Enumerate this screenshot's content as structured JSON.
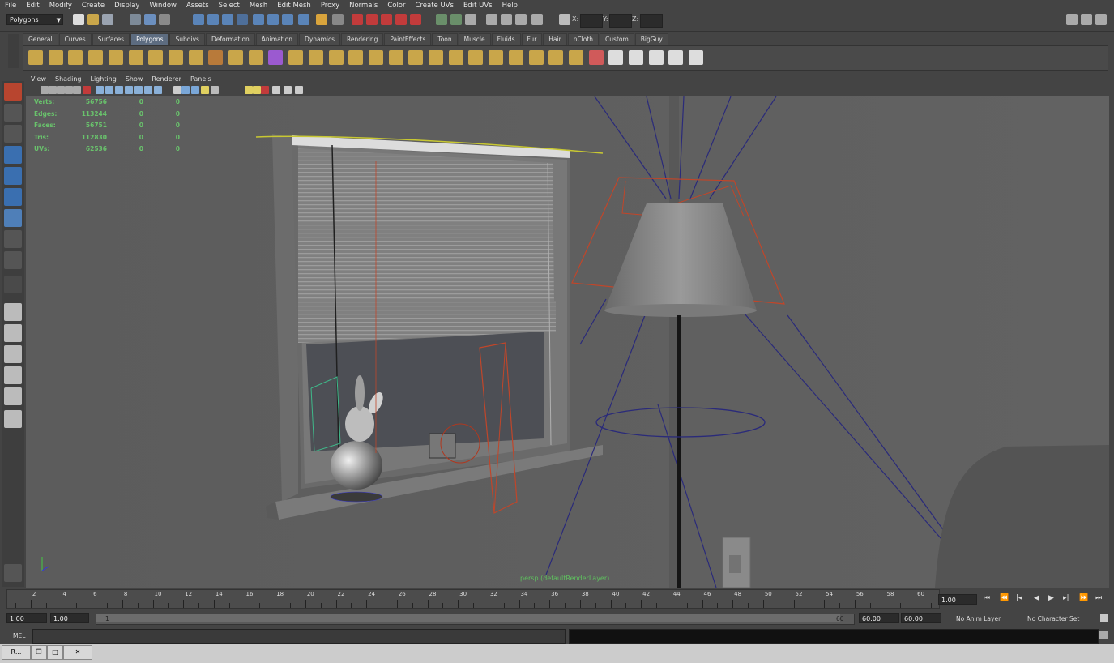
{
  "menubar": {
    "items": [
      "File",
      "Edit",
      "Modify",
      "Create",
      "Display",
      "Window",
      "Assets",
      "Select",
      "Mesh",
      "Edit Mesh",
      "Proxy",
      "Normals",
      "Color",
      "Create UVs",
      "Edit UVs",
      "Help"
    ]
  },
  "statusline": {
    "mode": "Polygons",
    "x_label": "X:",
    "y_label": "Y:",
    "z_label": "Z:"
  },
  "shelf": {
    "tabs": [
      "General",
      "Curves",
      "Surfaces",
      "Polygons",
      "Subdivs",
      "Deformation",
      "Animation",
      "Dynamics",
      "Rendering",
      "PaintEffects",
      "Toon",
      "Muscle",
      "Fluids",
      "Fur",
      "Hair",
      "nCloth",
      "Custom",
      "BigGuy"
    ],
    "active_tab": "Polygons"
  },
  "panel": {
    "menus": [
      "View",
      "Shading",
      "Lighting",
      "Show",
      "Renderer",
      "Panels"
    ],
    "camera_label": "persp (defaultRenderLayer)"
  },
  "hud": {
    "rows": [
      {
        "label": "Verts:",
        "value": "56756",
        "a": "0",
        "b": "0"
      },
      {
        "label": "Edges:",
        "value": "113244",
        "a": "0",
        "b": "0"
      },
      {
        "label": "Faces:",
        "value": "56751",
        "a": "0",
        "b": "0"
      },
      {
        "label": "Tris:",
        "value": "112830",
        "a": "0",
        "b": "0"
      },
      {
        "label": "UVs:",
        "value": "62536",
        "a": "0",
        "b": "0"
      }
    ]
  },
  "timeslider": {
    "ticks": [
      "2",
      "4",
      "6",
      "8",
      "10",
      "12",
      "14",
      "16",
      "18",
      "20",
      "22",
      "24",
      "26",
      "28",
      "30",
      "32",
      "34",
      "36",
      "38",
      "40",
      "42",
      "44",
      "46",
      "48",
      "50",
      "52",
      "54",
      "56",
      "58",
      "60"
    ],
    "current_frame": "1.00"
  },
  "range": {
    "start": "1.00",
    "playback_start": "1.00",
    "range_start_label": "1",
    "range_end_label": "60",
    "playback_end": "60.00",
    "end": "60.00",
    "anim_layer": "No Anim Layer",
    "character_set": "No Character Set"
  },
  "commandline": {
    "label": "MEL"
  },
  "taskbar": {
    "app_label": "R..."
  },
  "colors": {
    "viewport_bg": "#5f5f5f",
    "hud_text": "#69c36c",
    "selected_wire": "#c8c832",
    "light_lines": "#2a2a7a",
    "camera_wire": "#c0462a"
  }
}
